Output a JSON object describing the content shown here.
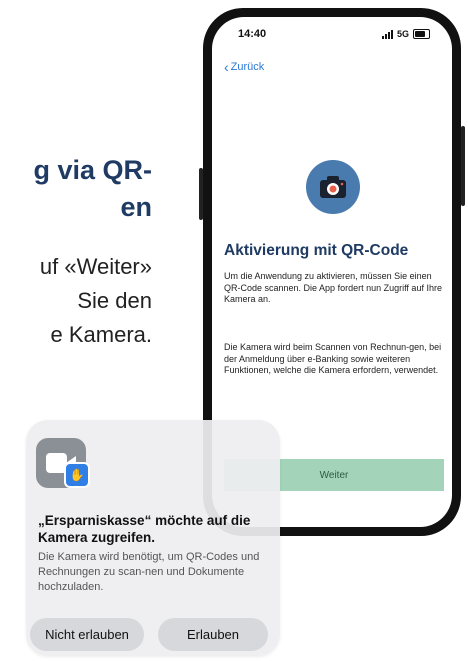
{
  "background_copy": {
    "headline_lines": [
      "g via QR-",
      "en"
    ],
    "sub_lines": [
      "uf «Weiter»",
      " Sie den",
      "e Kamera."
    ]
  },
  "phone": {
    "status": {
      "time": "14:40",
      "network": "5G"
    },
    "back_label": "Zurück",
    "title": "Aktivierung mit QR-Code",
    "paragraph1": "Um die Anwendung zu aktivieren, müssen Sie einen QR-Code scannen. Die App fordert nun Zugriff auf Ihre Kamera an.",
    "paragraph2": "Die Kamera wird beim Scannen von Rechnun-gen, bei der Anmeldung über e-Banking sowie weiteren Funktionen, welche die Kamera erfordern, verwendet.",
    "continue_label": "Weiter",
    "icons": {
      "back": "chevron-left-icon",
      "camera": "camera-icon"
    },
    "colors": {
      "accent_blue": "#1f3b63",
      "camera_circle": "#4a7bae",
      "button_green": "#a3d4b9",
      "link_blue": "#2a7ad4"
    }
  },
  "permission_dialog": {
    "title": "„Ersparniskasse“ möchte auf die Kamera zugreifen.",
    "message": "Die Kamera wird benötigt, um QR-Codes und Rechnungen zu scan-nen und Dokumente hochzuladen.",
    "deny_label": "Nicht erlauben",
    "allow_label": "Erlauben",
    "icons": {
      "app": "video-camera-app-icon",
      "badge": "hand-icon"
    }
  }
}
